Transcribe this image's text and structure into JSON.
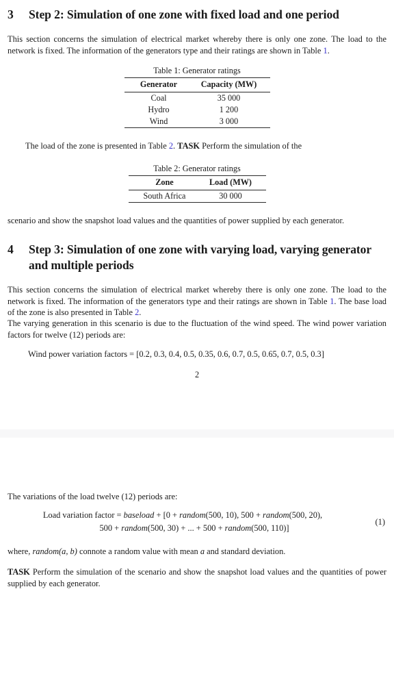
{
  "document": {
    "page_number": "2"
  },
  "sections": [
    {
      "number": "3",
      "title": "Step 2: Simulation of one zone with fixed load and one period"
    },
    {
      "number": "4",
      "title": "Step 3: Simulation of one zone with varying load, varying generator and multiple periods"
    }
  ],
  "paragraphs": {
    "s3_intro_a": "This section concerns the simulation of electrical market whereby there is only one zone. The load to the network is fixed. The information of the generators type and their ratings are shown in Table ",
    "s3_intro_ref": "1",
    "s3_intro_b": ".",
    "s3_after_t1_a": "The load of the zone is presented in Table ",
    "s3_after_t1_ref": "2",
    "s3_after_t1_b": ". ",
    "s3_after_t1_task": "TASK",
    "s3_after_t1_c": " Perform the simulation of the",
    "s3_after_t2": "scenario and show the snapshot load values and the quantities of power supplied by each generator.",
    "s4_intro_a": "This section concerns the simulation of electrical market whereby there is only one zone. The load to the network is fixed. The information of the generators type and their ratings are shown in Table ",
    "s4_intro_ref1": "1",
    "s4_intro_b": ". The base load of the zone is also presented in Table ",
    "s4_intro_ref2": "2",
    "s4_intro_c": ".",
    "s4_varying": "The varying generation in this scenario is due to the fluctuation of the wind speed. The wind power variation factors for twelve (12) periods are:",
    "load_variation_intro": "The variations of the load twelve (12) periods are:",
    "where_a": "where, ",
    "where_math": "random(a, b)",
    "where_b": " connote a random value with mean ",
    "where_mean": "a",
    "where_c": " and standard deviation.",
    "final_task_label": "TASK",
    "final_task_text": " Perform the simulation of the scenario and show the snapshot load values and the quantities of power supplied by each generator."
  },
  "equations": {
    "wind_label": "Wind power variation factors",
    "wind_eq": " = [0.2, 0.3, 0.4, 0.5, 0.35, 0.6, 0.7, 0.5, 0.65, 0.7, 0.5, 0.3]",
    "wind_values": [
      0.2,
      0.3,
      0.4,
      0.5,
      0.35,
      0.6,
      0.7,
      0.5,
      0.65,
      0.7,
      0.5,
      0.3
    ],
    "load_label": "Load variation factor",
    "load_eq_line1_pre": " = ",
    "load_eq_line1_baseload": "baseload",
    "load_eq_line1_mid": " + [0 + ",
    "load_eq_line1_rand1": "random",
    "load_eq_line1_args1": "(500, 10), 500 + ",
    "load_eq_line1_rand2": "random",
    "load_eq_line1_args2": "(500, 20),",
    "load_eq_line2_pre": "500 + ",
    "load_eq_line2_rand1": "random",
    "load_eq_line2_args1": "(500, 30) + ... + 500 + ",
    "load_eq_line2_rand2": "random",
    "load_eq_line2_args2": "(500, 110)]",
    "equation_number": "(1)"
  },
  "tables": [
    {
      "caption": "Table 1: Generator ratings",
      "columns": [
        "Generator",
        "Capacity (MW)"
      ],
      "rows": [
        [
          "Coal",
          "35 000"
        ],
        [
          "Hydro",
          "1 200"
        ],
        [
          "Wind",
          "3 000"
        ]
      ]
    },
    {
      "caption": "Table 2: Generator ratings",
      "columns": [
        "Zone",
        "Load (MW)"
      ],
      "rows": [
        [
          "South Africa",
          "30 000"
        ]
      ]
    }
  ],
  "colors": {
    "link": "#3a34cc",
    "text": "#1a1a1a",
    "page_gap": "#f7f7f8"
  }
}
